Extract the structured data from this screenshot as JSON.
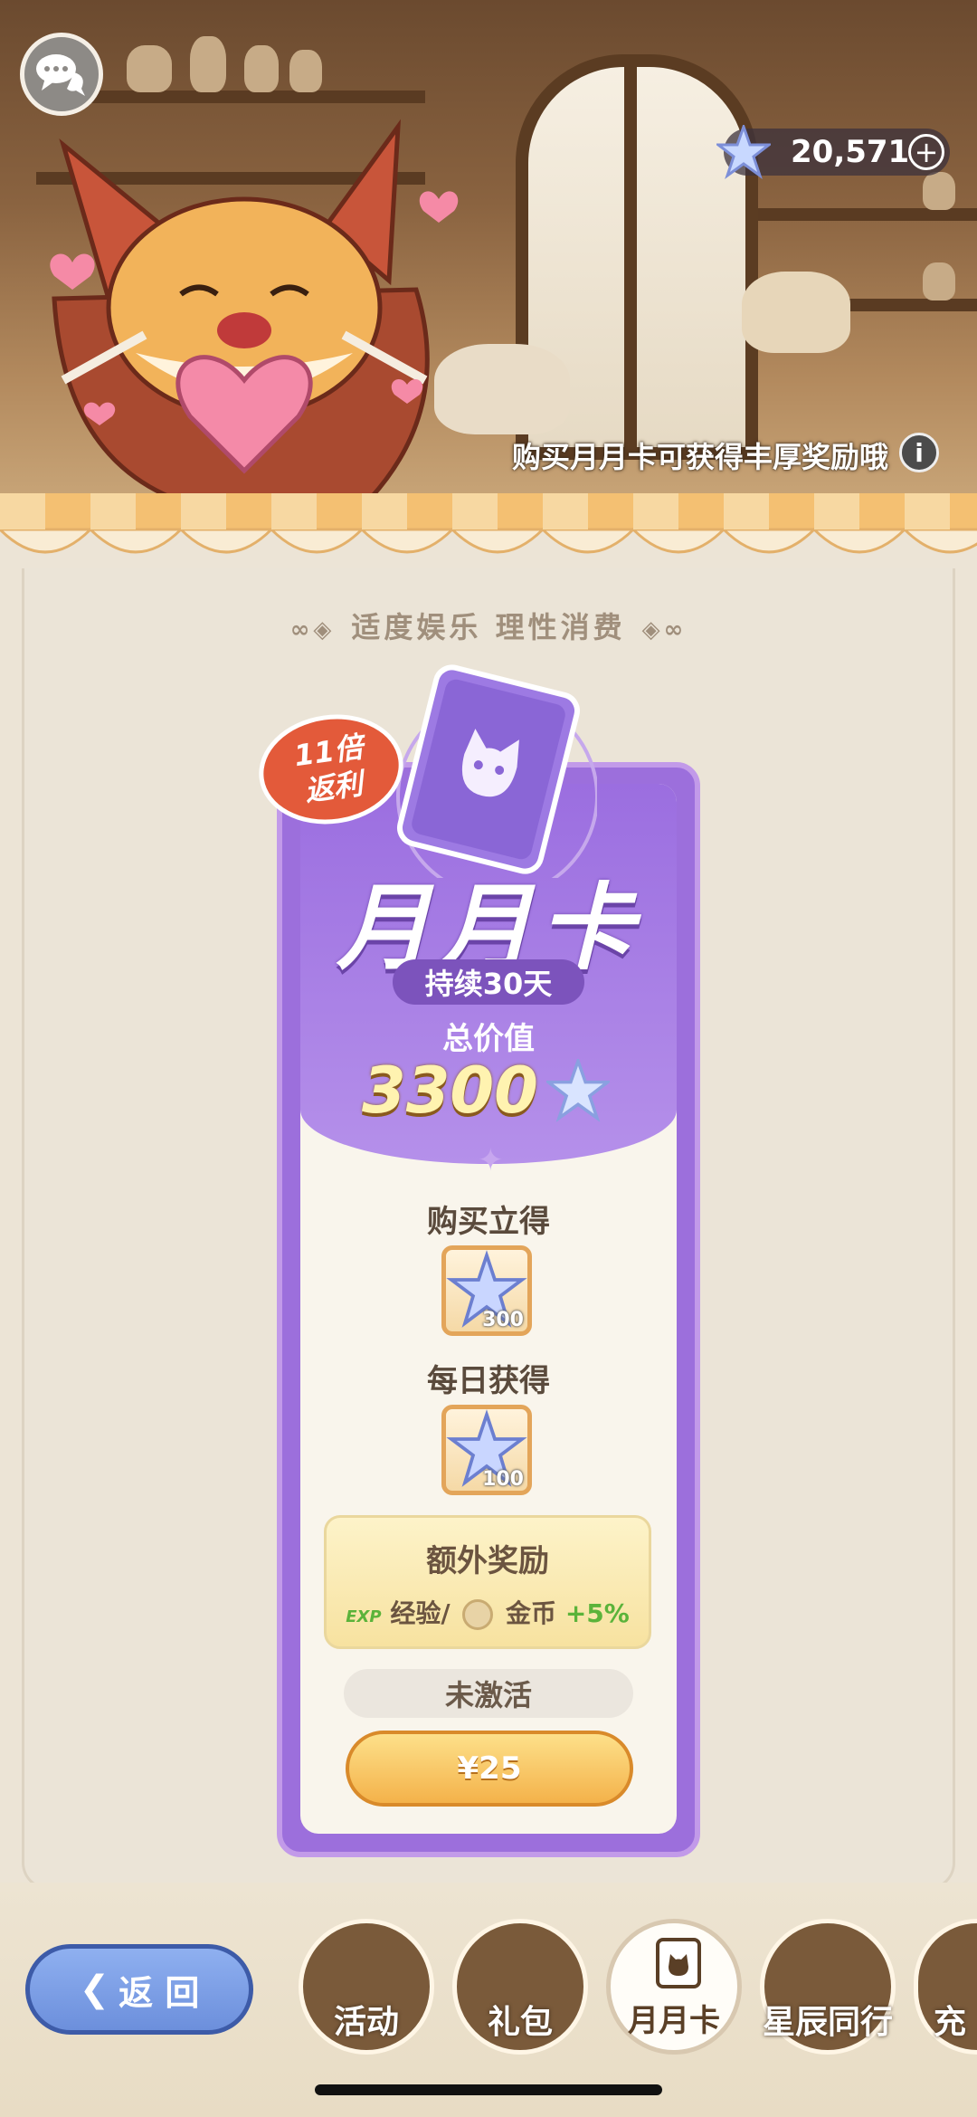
{
  "header": {
    "currency_value": "20,571",
    "currency_plus": "+",
    "hint_text": "购买月月卡可获得丰厚奖励哦",
    "info_icon": "i"
  },
  "slogan": "适度娱乐 理性消费",
  "card": {
    "badge_line1": "11倍",
    "badge_line2": "返利",
    "title": "月月卡",
    "duration": "持续30天",
    "total_label": "总价值",
    "total_value": "3300",
    "instant_label": "购买立得",
    "instant_amount": "300",
    "daily_label": "每日获得",
    "daily_amount": "100",
    "bonus_title": "额外奖励",
    "bonus_exp_tag": "EXP",
    "bonus_exp": "经验/",
    "bonus_gold": "金币",
    "bonus_pct": "+5%",
    "status": "未激活",
    "price": "¥25"
  },
  "nav": {
    "back_label": "返 回",
    "tabs": [
      {
        "label": "活动"
      },
      {
        "label": "礼包"
      },
      {
        "label": "月月卡",
        "active": true
      },
      {
        "label": "星辰同行"
      },
      {
        "label": "充"
      }
    ]
  },
  "colors": {
    "card_purple": "#9c6fdc",
    "price_orange": "#f4b24a",
    "badge_red": "#e35a3a",
    "back_blue": "#6c8fdc"
  }
}
